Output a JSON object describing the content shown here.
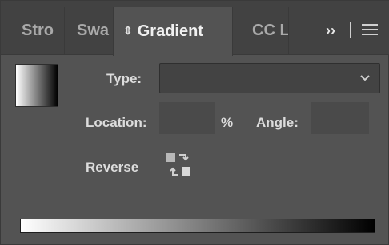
{
  "tabs": [
    {
      "label": "Stro"
    },
    {
      "label": "Swa"
    },
    {
      "label": "Gradient",
      "active": true
    },
    {
      "label": "CC L"
    }
  ],
  "tab_controls": {
    "more_label": "››",
    "more_icon": "double-chevron-right-icon",
    "menu_icon": "hamburger-menu-icon"
  },
  "gradient": {
    "type_label": "Type:",
    "type_value": "",
    "location_label": "Location:",
    "location_value": "",
    "location_unit": "%",
    "angle_label": "Angle:",
    "angle_value": "",
    "reverse_label": "Reverse",
    "reverse_icon": "reverse-gradient-icon",
    "preview_start_color": "#ffffff",
    "preview_end_color": "#000000"
  },
  "colors": {
    "panel_bg": "#535353",
    "tabbar_bg": "#424242",
    "field_bg": "#4a4a4a",
    "text": "#dcdcdc"
  }
}
